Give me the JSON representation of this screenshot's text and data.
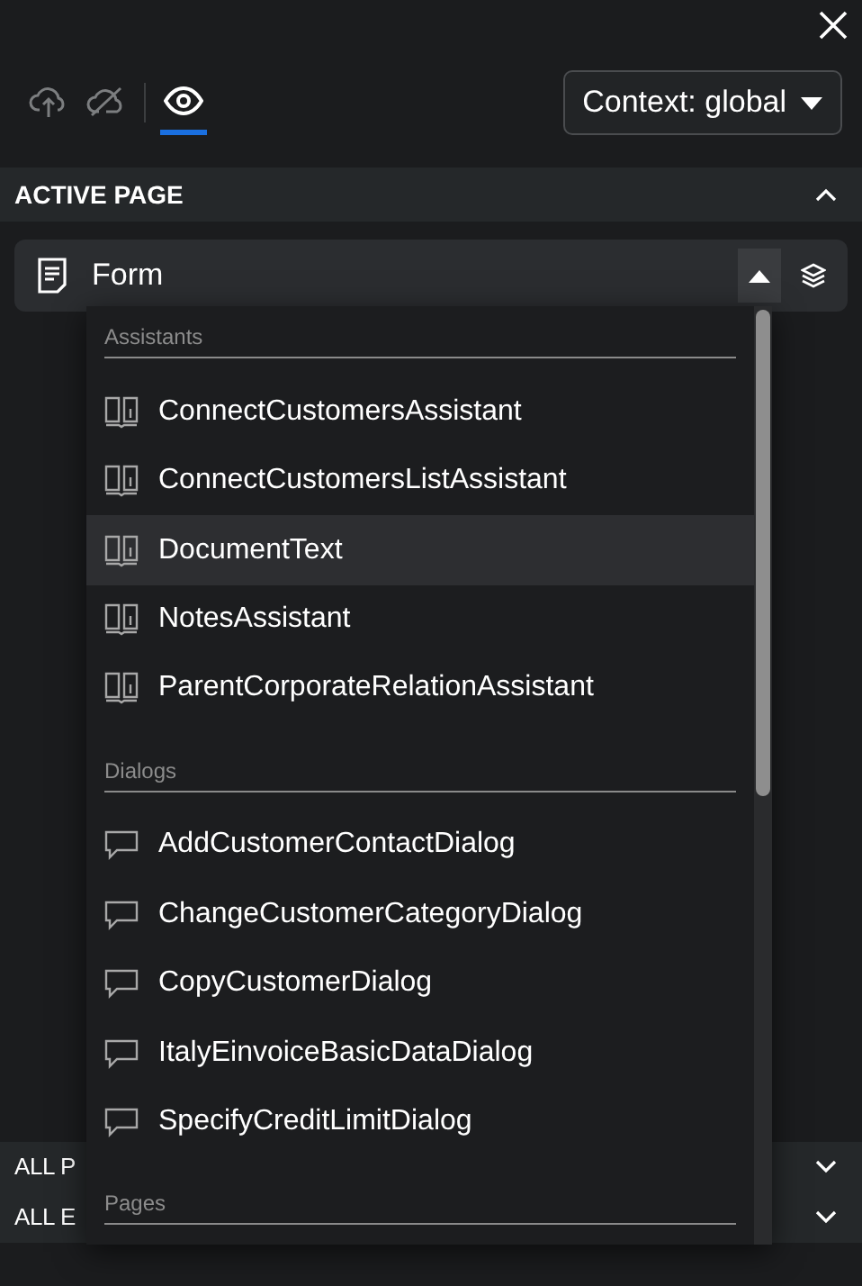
{
  "toolbar": {
    "tabs": [
      {
        "kind": "cloud-upload",
        "selected": false
      },
      {
        "kind": "cloud-off",
        "selected": false
      },
      {
        "kind": "eye",
        "selected": true
      }
    ],
    "context_button": "Context: global"
  },
  "active_page": {
    "title": "ACTIVE PAGE",
    "expanded": true,
    "combo": {
      "value": "Form",
      "open": true
    }
  },
  "dropdown": {
    "groups": [
      {
        "label": "Assistants",
        "kind": "assistant",
        "items": [
          {
            "label": "ConnectCustomersAssistant",
            "selected": false
          },
          {
            "label": "ConnectCustomersListAssistant",
            "selected": false
          },
          {
            "label": "DocumentText",
            "selected": true
          },
          {
            "label": "NotesAssistant",
            "selected": false
          },
          {
            "label": "ParentCorporateRelationAssistant",
            "selected": false
          }
        ]
      },
      {
        "label": "Dialogs",
        "kind": "dialog",
        "items": [
          {
            "label": "AddCustomerContactDialog",
            "selected": false
          },
          {
            "label": "ChangeCustomerCategoryDialog",
            "selected": false
          },
          {
            "label": "CopyCustomerDialog",
            "selected": false
          },
          {
            "label": "ItalyEinvoiceBasicDataDialog",
            "selected": false
          },
          {
            "label": "SpecifyCreditLimitDialog",
            "selected": false
          }
        ]
      },
      {
        "label": "Pages",
        "kind": "page"
      }
    ]
  },
  "sections": [
    {
      "title": "ALL P",
      "expanded": false
    },
    {
      "title": "ALL E",
      "expanded": false
    }
  ]
}
